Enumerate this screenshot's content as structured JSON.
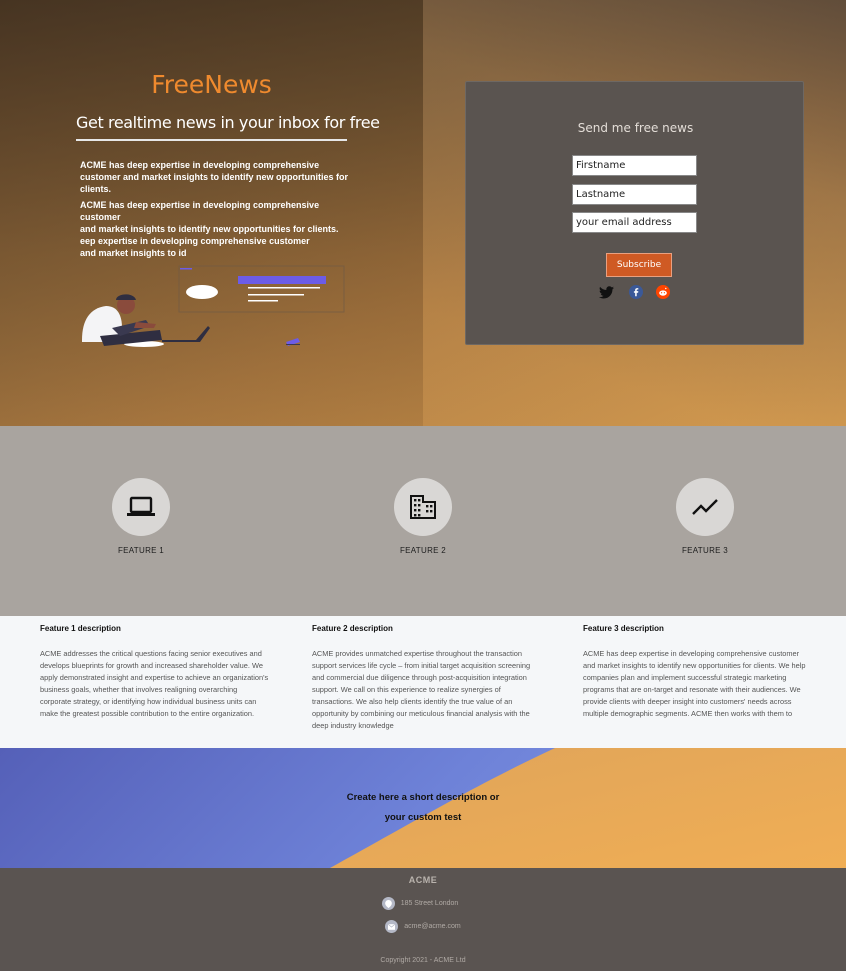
{
  "hero": {
    "brand": "FreeNews",
    "tagline": "Get realtime news in your inbox for free",
    "paragraph1": "ACME has deep expertise in developing comprehensive customer and market insights to identify new opportunities for clients.",
    "paragraph2_lines": [
      "ACME has deep expertise in developing comprehensive customer",
      "and market insights to identify new opportunities for clients.",
      "eep expertise in developing comprehensive customer",
      "and market insights to id"
    ]
  },
  "signup": {
    "title": "Send me free news",
    "firstname_placeholder": "Firstname",
    "lastname_placeholder": "Lastname",
    "email_placeholder": "your email address",
    "subscribe_label": "Subscribe",
    "social_icons": [
      "twitter-icon",
      "facebook-icon",
      "reddit-icon"
    ]
  },
  "features": [
    {
      "label": "FEATURE 1",
      "icon": "laptop-icon"
    },
    {
      "label": "FEATURE 2",
      "icon": "building-icon"
    },
    {
      "label": "FEATURE 3",
      "icon": "trend-line-icon"
    }
  ],
  "descriptions": [
    {
      "title": "Feature 1 description",
      "text": "ACME addresses the critical questions facing senior executives and develops blueprints for growth and increased shareholder value. We apply demonstrated insight and expertise to achieve an organization's business goals, whether that involves realigning overarching corporate strategy, or identifying how individual business units can make the greatest possible contribution to the entire organization."
    },
    {
      "title": "Feature 2 description",
      "text": "ACME provides unmatched expertise throughout the transaction support services life cycle – from initial target acquisition screening and commercial due diligence through post-acquisition integration support. We call on this experience to realize synergies of transactions. We also help clients identify the true value of an opportunity by combining our meticulous financial analysis with the deep industry knowledge"
    },
    {
      "title": "Feature 3 description",
      "text": "ACME has deep expertise in developing comprehensive customer and market insights to identify new opportunities for clients. We help companies plan and implement successful strategic marketing programs that are on-target and resonate with their audiences. We provide clients with deeper insight into customers' needs across multiple demographic segments. ACME then works with them to"
    }
  ],
  "cta": {
    "line1": "Create here a short description or",
    "line2": "your custom test"
  },
  "footer": {
    "brand": "ACME",
    "address": "185 Street London",
    "email": "acme@acme.com",
    "copyright": "Copyright 2021 - ACME Ltd"
  },
  "colors": {
    "brand_orange": "#ef8a2e",
    "subscribe_bg": "#cf5a24",
    "features_bg": "#a9a49f",
    "footer_bg": "#5a5451"
  }
}
